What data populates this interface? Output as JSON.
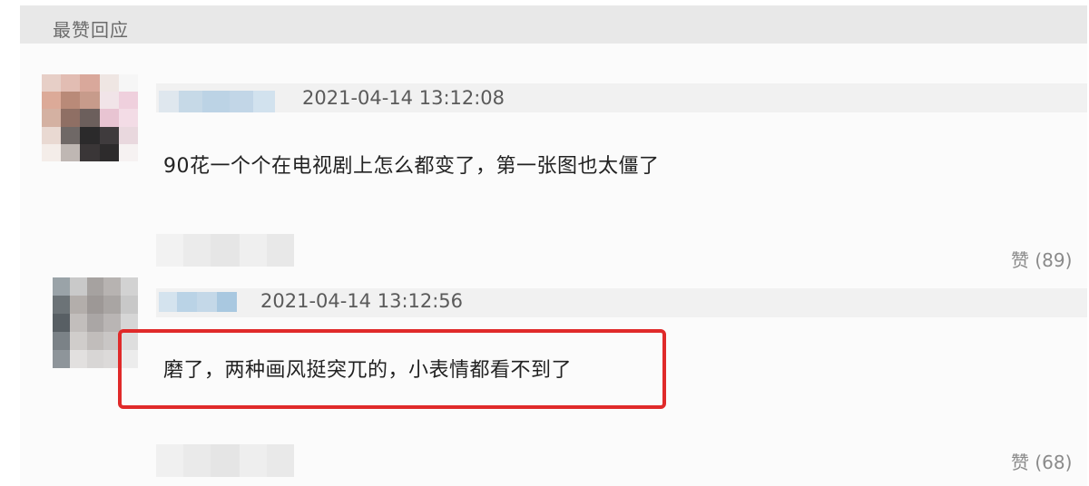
{
  "section": {
    "title": "最赞回应"
  },
  "comments": [
    {
      "timestamp": "2021-04-14 13:12:08",
      "text": "90花一个个在电视剧上怎么都变了，第一张图也太僵了",
      "like_label": "赞 (89)"
    },
    {
      "timestamp": "2021-04-14 13:12:56",
      "text": "磨了，两种画风挺突兀的，小表情都看不到了",
      "like_label": "赞 (68)",
      "highlighted": true
    }
  ],
  "colors": {
    "highlight": "#e02a2a",
    "header_bg": "#e8e8e8",
    "timestamp": "#5a5a5a"
  }
}
